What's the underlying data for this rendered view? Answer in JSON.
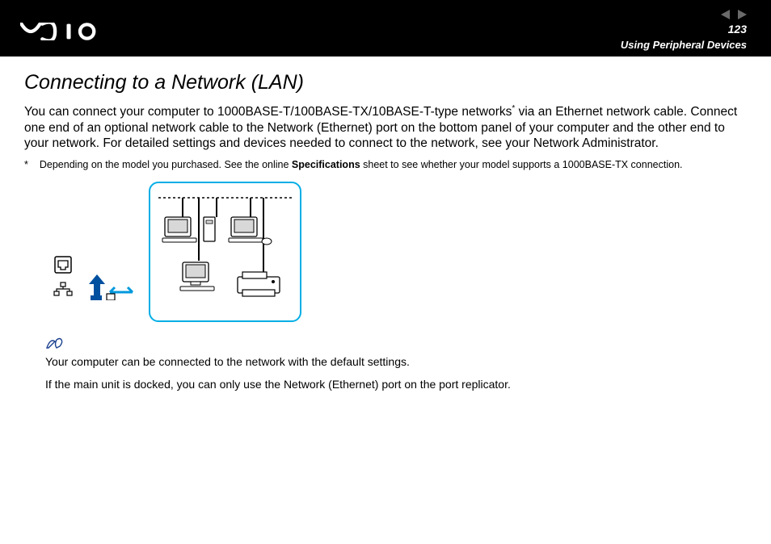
{
  "header": {
    "page_number": "123",
    "section": "Using Peripheral Devices"
  },
  "title": "Connecting to a Network (LAN)",
  "paragraph1_a": "You can connect your computer to 1000BASE-T/100BASE-TX/10BASE-T-type networks",
  "paragraph1_b": " via an Ethernet network cable. Connect one end of an optional network cable to the Network (Ethernet) port on the bottom panel of your computer and the other end to your network. For detailed settings and devices needed to connect to the network, see your Network Administrator.",
  "footnote_star": "*",
  "footnote_a": "Depending on the model you purchased. See the online ",
  "footnote_spec": "Specifications",
  "footnote_b": " sheet to see whether your model supports a 1000BASE-TX connection.",
  "note1": "Your computer can be connected to the network with the default settings.",
  "note2": "If the main unit is docked, you can only use the Network (Ethernet) port on the port replicator."
}
